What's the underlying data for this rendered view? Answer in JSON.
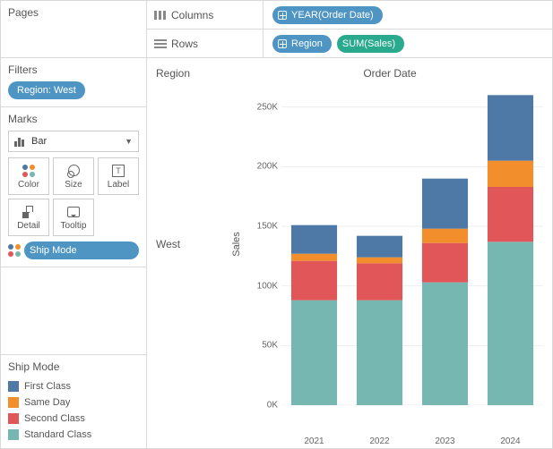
{
  "shelves": {
    "columns_label": "Columns",
    "rows_label": "Rows",
    "columns_pills": [
      {
        "label": "YEAR(Order Date)",
        "color": "blue",
        "expand": true
      }
    ],
    "rows_pills": [
      {
        "label": "Region",
        "color": "blue",
        "expand": true
      },
      {
        "label": "SUM(Sales)",
        "color": "teal",
        "expand": false
      }
    ]
  },
  "pages": {
    "title": "Pages"
  },
  "filters": {
    "title": "Filters",
    "items": [
      {
        "label": "Region: West"
      }
    ]
  },
  "marks": {
    "title": "Marks",
    "type_label": "Bar",
    "buttons": [
      {
        "id": "color",
        "label": "Color"
      },
      {
        "id": "size",
        "label": "Size"
      },
      {
        "id": "label",
        "label": "Label"
      },
      {
        "id": "detail",
        "label": "Detail"
      },
      {
        "id": "tooltip",
        "label": "Tooltip"
      }
    ],
    "assignments": [
      {
        "target": "color",
        "pill": "Ship Mode"
      }
    ]
  },
  "legend": {
    "title": "Ship Mode",
    "items": [
      {
        "label": "First Class",
        "color": "#4e79a7"
      },
      {
        "label": "Same Day",
        "color": "#f28e2b"
      },
      {
        "label": "Second Class",
        "color": "#e15759"
      },
      {
        "label": "Standard Class",
        "color": "#76b7b2"
      }
    ]
  },
  "viz": {
    "region_header": "Region",
    "column_header": "Order Date",
    "row_value": "West",
    "y_axis_label": "Sales"
  },
  "chart_data": {
    "type": "bar",
    "stacked": true,
    "categories": [
      "2021",
      "2022",
      "2023",
      "2024"
    ],
    "series": [
      {
        "name": "Standard Class",
        "color": "#76b7b2",
        "values": [
          88000,
          88000,
          103000,
          137000
        ]
      },
      {
        "name": "Second Class",
        "color": "#e15759",
        "values": [
          33000,
          31000,
          33000,
          46000
        ]
      },
      {
        "name": "Same Day",
        "color": "#f28e2b",
        "values": [
          6000,
          5000,
          12000,
          22000
        ]
      },
      {
        "name": "First Class",
        "color": "#4e79a7",
        "values": [
          24000,
          18000,
          42000,
          55000
        ]
      }
    ],
    "ylim": [
      0,
      270000
    ],
    "yticks": [
      0,
      50000,
      100000,
      150000,
      200000,
      250000
    ],
    "ytick_labels": [
      "0K",
      "50K",
      "100K",
      "150K",
      "200K",
      "250K"
    ],
    "xlabel": "",
    "ylabel": "Sales"
  }
}
